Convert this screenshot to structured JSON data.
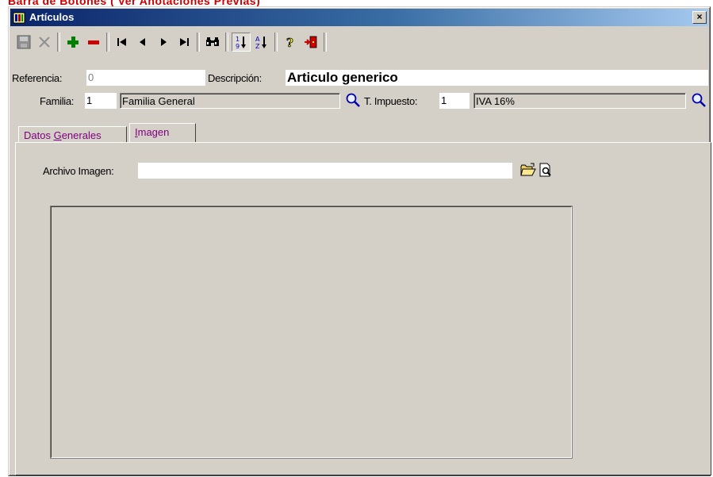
{
  "heading": "Barra de Botones ( Ver Anotaciones Previas)",
  "window": {
    "title": "Artículos",
    "close_label": "×"
  },
  "toolbar": {
    "buttons": [
      {
        "name": "save-icon"
      },
      {
        "name": "cancel-icon"
      },
      {
        "name": "add-icon",
        "color": "#008000"
      },
      {
        "name": "delete-icon",
        "color": "#cc0000"
      },
      {
        "name": "first-record-icon"
      },
      {
        "name": "previous-record-icon"
      },
      {
        "name": "next-record-icon"
      },
      {
        "name": "last-record-icon"
      },
      {
        "name": "find-icon"
      },
      {
        "name": "sort-numeric-icon"
      },
      {
        "name": "sort-alpha-icon"
      },
      {
        "name": "help-icon"
      },
      {
        "name": "exit-icon"
      }
    ]
  },
  "form": {
    "referencia_label": "Referencia:",
    "referencia_value": "0",
    "descripcion_label": "Descripción:",
    "descripcion_value": "Articulo generico",
    "familia_label": "Familia:",
    "familia_code": "1",
    "familia_name": "Familia General",
    "impuesto_label": "T. Impuesto:",
    "impuesto_code": "1",
    "impuesto_name": "IVA 16%"
  },
  "tabs": [
    {
      "label_pre": "Datos ",
      "label_u": "G",
      "label_post": "enerales"
    },
    {
      "label_pre": "",
      "label_u": "I",
      "label_post": "magen"
    }
  ],
  "active_tab": "Imagen",
  "imagen": {
    "archivo_label": "Archivo Imagen:",
    "archivo_value": ""
  },
  "colors": {
    "title_bar_start": "#0a246a",
    "heading": "#cc0000",
    "tab_text": "#800080",
    "face": "#d4d0c8"
  }
}
